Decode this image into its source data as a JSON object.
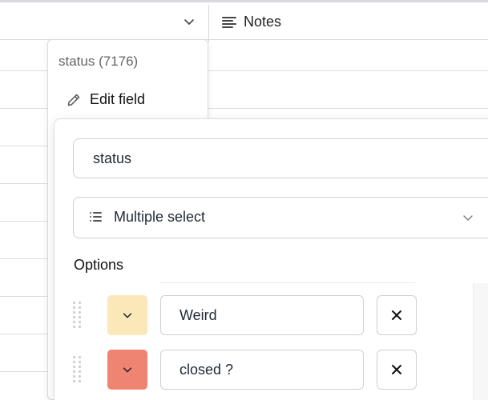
{
  "header": {
    "notes_column_label": "Notes",
    "notes_icon": "long-text-icon",
    "field_chevron_icon": "chevron-down-icon"
  },
  "field_menu": {
    "title": "status (7176)",
    "edit_field_label": "Edit field",
    "edit_icon": "pencil-icon"
  },
  "edit_field_form": {
    "name_value": "status",
    "type_select": {
      "icon": "list-icon",
      "value": "Multiple select"
    },
    "options_label": "Options",
    "options": [
      {
        "value": "Weird",
        "color": "#fbe8b8",
        "drag_icon": "drag-handle-icon",
        "color_chevron_icon": "chevron-down-icon",
        "remove_icon": "close-icon"
      },
      {
        "value": "closed ?",
        "color": "#ef8473",
        "drag_icon": "drag-handle-icon",
        "color_chevron_icon": "chevron-down-icon",
        "remove_icon": "close-icon"
      }
    ]
  }
}
